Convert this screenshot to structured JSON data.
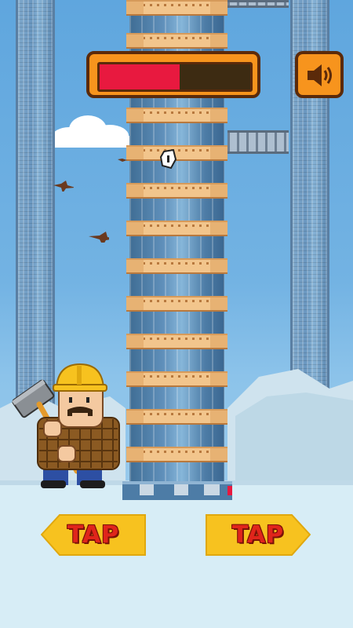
{
  "game": {
    "timer": {
      "fill_fraction": 0.53,
      "fill_color": "#e8193f",
      "frame_color": "#f7941d",
      "border_color": "#5b2a0a"
    },
    "sound_button": {
      "icon": "speaker-icon",
      "state": "on"
    },
    "left_button": {
      "label": "TAP"
    },
    "right_button": {
      "label": "TAP"
    },
    "player": {
      "character": "construction-worker",
      "side": "left",
      "tool": "sledgehammer"
    },
    "tower": {
      "floors_visible": 13,
      "branch_sides": [
        "right",
        "none",
        "right"
      ]
    },
    "colors": {
      "sky": "#73b3e3",
      "snow": "#d7edf6",
      "floor": "#f2c58c",
      "tap_text": "#e0251b",
      "tap_bg": "#f7c21f"
    }
  }
}
